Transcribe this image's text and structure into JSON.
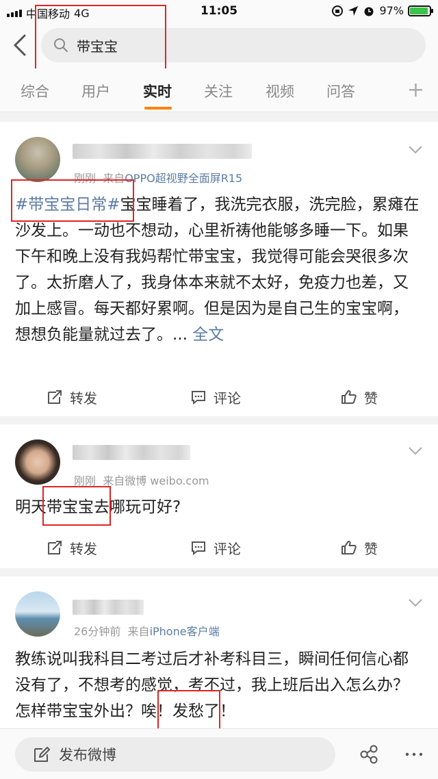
{
  "status_bar": {
    "carrier": "中国移动",
    "network": "4G",
    "time": "11:05",
    "battery": "97%"
  },
  "search": {
    "query": "带宝宝"
  },
  "tabs": [
    {
      "label": "综合"
    },
    {
      "label": "用户"
    },
    {
      "label": "实时"
    },
    {
      "label": "关注"
    },
    {
      "label": "视频"
    },
    {
      "label": "问答"
    }
  ],
  "tabs_plus": "+",
  "posts": [
    {
      "meta_time": "刚刚",
      "meta_from": "来自",
      "meta_source": "OPPO超视野全面屏R15",
      "topic": "#带宝宝日常#",
      "text": "宝宝睡着了，我洗完衣服，洗完脸，累瘫在沙发上。一动也不想动，心里祈祷他能够多睡一下。如果下午和晚上没有我妈帮忙带宝宝，我觉得可能会哭很多次了。太折磨人了，我身体本来就不太好，免疫力也差，又加上感冒。每天都好累啊。但是因为是自己生的宝宝啊，想想负能量就过去了。... ",
      "full_text": "全文"
    },
    {
      "meta_time": "刚刚",
      "meta_from": "来自微博",
      "meta_source": "weibo.com",
      "text": "明天带宝宝去哪玩可好?"
    },
    {
      "meta_time": "26分钟前",
      "meta_from": "来自",
      "meta_source": "iPhone客户端",
      "text": "教练说叫我科目二考过后才补考科目三，瞬间任何信心都没有了，不想考的感觉，考不过，我上班后出入怎么办？怎样带宝宝外出？唉！发愁了！"
    }
  ],
  "actions": {
    "repost": "转发",
    "comment": "评论",
    "like": "赞"
  },
  "bottom": {
    "compose": "发布微博"
  },
  "colors": {
    "accent": "#ff8200",
    "link": "#5b7ca3",
    "highlight_box": "#e02424"
  }
}
